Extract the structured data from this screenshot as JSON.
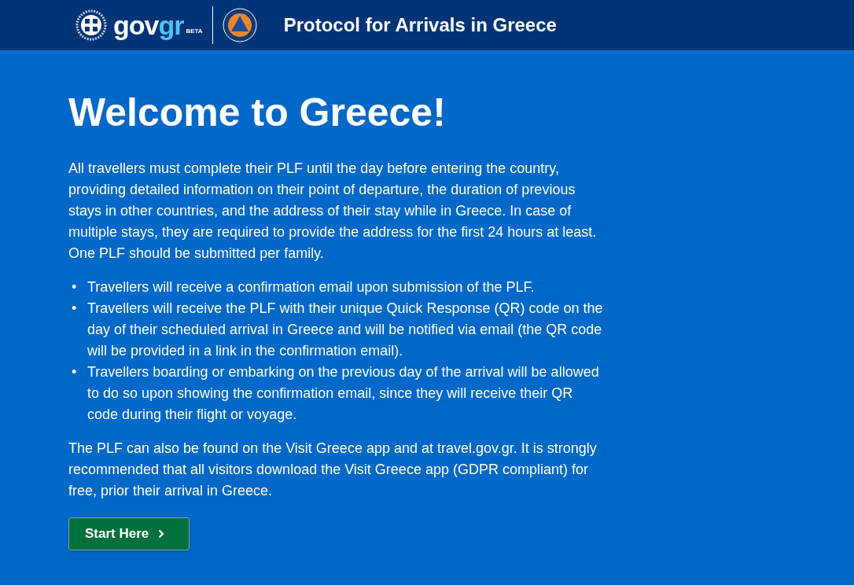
{
  "header": {
    "wordmark": {
      "main": "gov",
      "accent": "gr"
    },
    "badge": "BETA",
    "title": "Protocol for Arrivals in Greece"
  },
  "main": {
    "heading": "Welcome to Greece!",
    "intro": "All travellers must complete their PLF until the day before entering the country, providing detailed information on their point of departure, the duration of previous stays in other countries, and the address of their stay while in Greece. In case of multiple stays, they are required to provide the address for the first 24 hours at least. One PLF should be submitted per family.",
    "bullets": [
      {
        "marker": "•",
        "text": "Travellers will receive a confirmation email upon submission of the PLF."
      },
      {
        "marker": "•",
        "text": "Travellers will receive the PLF with their unique Quick Response (QR) code on the day of their scheduled arrival in Greece and will be notified via email (the QR code will be provided in a link in the confirmation email)."
      },
      {
        "marker": "•",
        "text": "Travellers boarding or embarking on the previous day of the arrival will be allowed to do so upon showing the confirmation email, since they will receive their QR code during their flight or voyage."
      }
    ],
    "outro": "The PLF can also be found on the Visit Greece app and at travel.gov.gr. It is strongly recommended that all visitors download the Visit Greece app (GDPR compliant) for free, prior their arrival in Greece.",
    "button": "Start Here"
  }
}
